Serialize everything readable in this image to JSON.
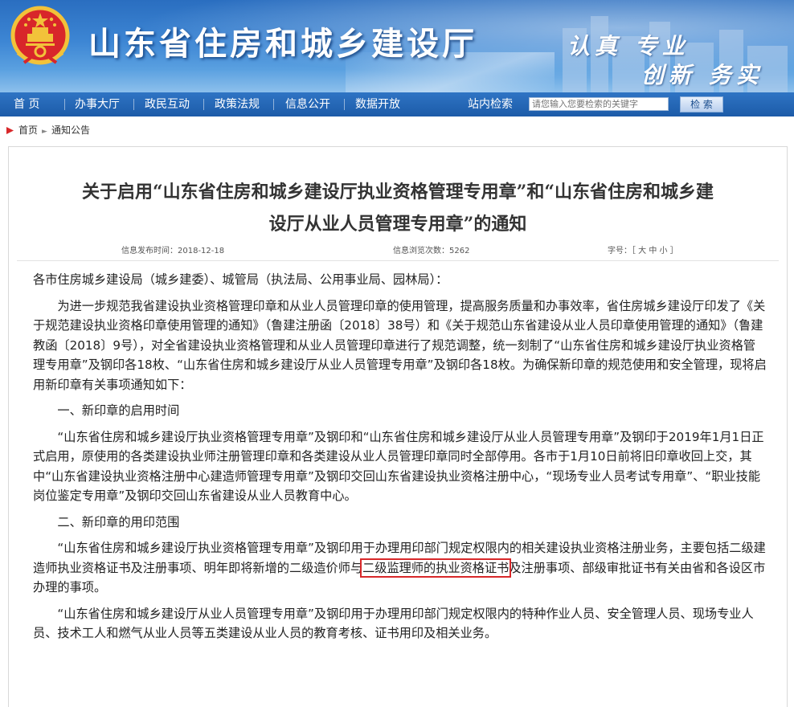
{
  "header": {
    "site_title": "山东省住房和城乡建设厅",
    "motto_line1": "认真 专业",
    "motto_line2": "创新 务实"
  },
  "nav": {
    "items": [
      "首 页",
      "办事大厅",
      "政民互动",
      "政策法规",
      "信息公开",
      "数据开放"
    ],
    "search_label": "站内检索",
    "search_placeholder": "请您输入您要检索的关键字",
    "search_button": "检 索"
  },
  "breadcrumb": {
    "home": "首页",
    "current": "通知公告"
  },
  "article": {
    "title_line1": "关于启用“山东省住房和城乡建设厅执业资格管理专用章”和“山东省住房和城乡建",
    "title_line2": "设厅从业人员管理专用章”的通知",
    "publish_time": "信息发布时间：2018-12-18",
    "view_count": "信息浏览次数：5262",
    "font_size_label": "字号：［ 大 中 小 ］",
    "salutation": "各市住房城乡建设局（城乡建委）、城管局（执法局、公用事业局、园林局）：",
    "para1": "为进一步规范我省建设执业资格管理印章和从业人员管理印章的使用管理，提高服务质量和办事效率，省住房城乡建设厅印发了《关于规范建设执业资格印章使用管理的通知》（鲁建注册函〔2018〕38号）和《关于规范山东省建设从业人员印章使用管理的通知》（鲁建教函〔2018〕9号），对全省建设执业资格管理和从业人员管理印章进行了规范调整，统一刻制了“山东省住房和城乡建设厅执业资格管理专用章”及钢印各18枚、“山东省住房和城乡建设厅从业人员管理专用章”及钢印各18枚。为确保新印章的规范使用和安全管理，现将启用新印章有关事项通知如下：",
    "heading1": "一、新印章的启用时间",
    "para2": "“山东省住房和城乡建设厅执业资格管理专用章”及钢印和“山东省住房和城乡建设厅从业人员管理专用章”及钢印于2019年1月1日正式启用，原使用的各类建设执业师注册管理印章和各类建设从业人员管理印章同时全部停用。各市于1月10日前将旧印章收回上交，其中“山东省建设执业资格注册中心建造师管理专用章”及钢印交回山东省建设执业资格注册中心，“现场专业人员考试专用章”、“职业技能岗位鉴定专用章”及钢印交回山东省建设从业人员教育中心。",
    "heading2": "二、新印章的用印范围",
    "para3_before": "“山东省住房和城乡建设厅执业资格管理专用章”及钢印用于办理用印部门规定权限内的相关建设执业资格注册业务，主要包括二级建造师执业资格证书及注册事项、明年即将新增的二级造价师与",
    "para3_highlight": "二级监理师的执业资格证书",
    "para3_after": "及注册事项、部级审批证书有关由省和各设区市办理的事项。",
    "para4": "“山东省住房和城乡建设厅从业人员管理专用章”及钢印用于办理用印部门规定权限内的特种作业人员、安全管理人员、现场专业人员、技术工人和燃气从业人员等五类建设从业人员的教育考核、证书用印及相关业务。"
  },
  "colors": {
    "banner": "#3d86d4",
    "nav": "#2366b5",
    "highlight_border": "#d8282a"
  }
}
